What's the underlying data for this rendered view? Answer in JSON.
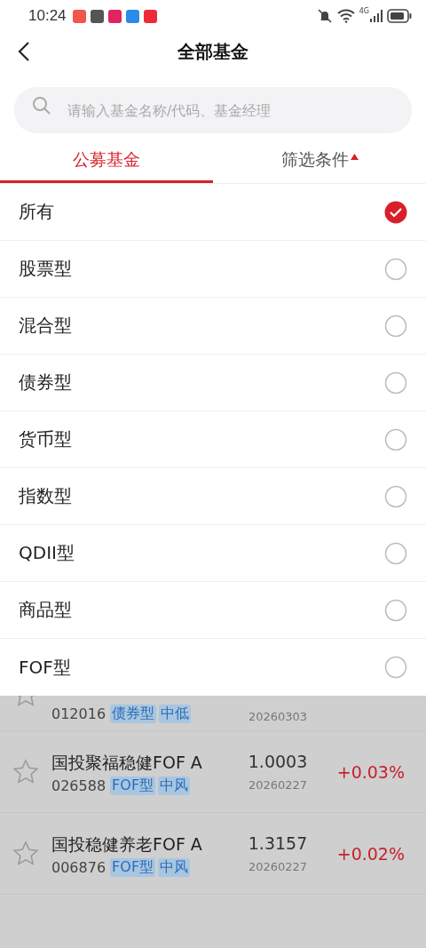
{
  "status_bar": {
    "time": "10:24",
    "network": "4G"
  },
  "header": {
    "title": "全部基金"
  },
  "search": {
    "placeholder": "请输入基金名称/代码、基金经理"
  },
  "tabs": [
    {
      "label": "公募基金",
      "selected": true,
      "kind": "plain"
    },
    {
      "label": "筛选条件",
      "selected": false,
      "kind": "filter"
    }
  ],
  "options": [
    {
      "label": "所有",
      "selected": true
    },
    {
      "label": "股票型",
      "selected": false
    },
    {
      "label": "混合型",
      "selected": false
    },
    {
      "label": "债券型",
      "selected": false
    },
    {
      "label": "货币型",
      "selected": false
    },
    {
      "label": "指数型",
      "selected": false
    },
    {
      "label": "QDII型",
      "selected": false
    },
    {
      "label": "商品型",
      "selected": false
    },
    {
      "label": "FOF型",
      "selected": false
    }
  ],
  "partial_row": {
    "code": "012016",
    "tags": [
      "债券型",
      "中低"
    ],
    "date": "20260303"
  },
  "funds": [
    {
      "name": "国投聚福稳健FOF A",
      "code": "026588",
      "tags": [
        "FOF型",
        "中风"
      ],
      "nav": "1.0003",
      "date": "20260227",
      "change": "+0.03%"
    },
    {
      "name": "国投稳健养老FOF A",
      "code": "006876",
      "tags": [
        "FOF型",
        "中风"
      ],
      "nav": "1.3157",
      "date": "20260227",
      "change": "+0.02%"
    }
  ]
}
